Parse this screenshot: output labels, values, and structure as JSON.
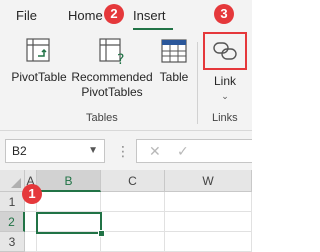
{
  "tabs": [
    {
      "label": "File"
    },
    {
      "label": "Home"
    },
    {
      "label": "Insert",
      "active": true
    }
  ],
  "badges": [
    "1",
    "2",
    "3"
  ],
  "ribbon": {
    "groups": [
      {
        "label": "Tables"
      },
      {
        "label": "Links"
      }
    ],
    "commands": {
      "pivottable": "PivotTable",
      "recommended_line1": "Recommended",
      "recommended_line2": "PivotTables",
      "table": "Table",
      "link": "Link"
    }
  },
  "formula_bar": {
    "name_box": "B2",
    "dots": "⋮",
    "cancel_icon": "✕",
    "confirm_icon": "✓"
  },
  "sheet": {
    "columns": [
      "A",
      "B",
      "C",
      "W"
    ],
    "rows": [
      "1",
      "2",
      "3"
    ],
    "active_cell": "B2"
  },
  "colors": {
    "accent": "#217346",
    "badge": "#e5383b"
  }
}
